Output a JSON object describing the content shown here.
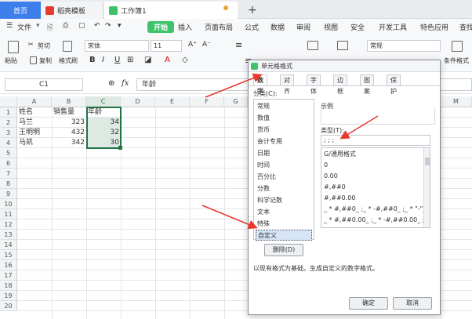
{
  "tabs": {
    "home": "首页",
    "template": "稻壳模板",
    "workbook": "工作簿1",
    "new_tab": "+"
  },
  "menu": {
    "items": [
      "文件",
      "开始",
      "插入",
      "页面布局",
      "公式",
      "数据",
      "审阅",
      "视图",
      "安全",
      "开发工具",
      "特色应用",
      "查找"
    ]
  },
  "toolbar": {
    "paste": "粘贴",
    "cut": "剪切",
    "copy": "复制",
    "format_painter": "格式刷",
    "font_name": "宋体",
    "font_size": "11",
    "number_format": "常规",
    "bold": "B",
    "italic": "I",
    "underline": "U",
    "font_color_glyph": "A",
    "conditional_format": "条件格式"
  },
  "formula_bar": {
    "cell_ref": "C1",
    "fx": "fx",
    "value": "年龄"
  },
  "sheet": {
    "columns": [
      "A",
      "B",
      "C",
      "D",
      "E",
      "F",
      "G",
      "M"
    ],
    "rows": [
      "1",
      "2",
      "3",
      "4",
      "5",
      "6",
      "7",
      "8",
      "9",
      "10",
      "11",
      "12",
      "13",
      "14",
      "15",
      "16",
      "17",
      "18",
      "19",
      "20"
    ],
    "header": [
      "姓名",
      "销售量",
      "年龄"
    ],
    "data": [
      [
        "马兰",
        "323",
        "34"
      ],
      [
        "王明明",
        "432",
        "32"
      ],
      [
        "马凯",
        "342",
        "30"
      ]
    ]
  },
  "dialog": {
    "title": "单元格格式",
    "tabs": [
      "数字",
      "对齐",
      "字体",
      "边框",
      "图案",
      "保护"
    ],
    "category_label": "分类(C):",
    "categories": [
      "常规",
      "数值",
      "货币",
      "会计专用",
      "日期",
      "时间",
      "百分比",
      "分数",
      "科学记数",
      "文本",
      "特殊",
      "自定义"
    ],
    "selected_category": "自定义",
    "sample_label": "示例",
    "type_label": "类型(T):",
    "type_value": ";  ;  ;",
    "formats": [
      "G/通用格式",
      "0",
      "0.00",
      "#,##0",
      "#,##0.00",
      "_ * #,##0_ ;_ * -#,##0_ ;_ * \"-\"_",
      "_ * #,##0.00_ ;_ * -#,##0.00_ ;_ *"
    ],
    "delete_button": "删除(D)",
    "description": "以现有格式为基础，生成自定义的数字格式。",
    "ok_button": "确定",
    "cancel_button": "取消"
  },
  "colors": {
    "accent_blue": "#3c7eea",
    "start_green": "#3ec36a",
    "selection_green": "#217346",
    "arrow_red": "#e8392f"
  }
}
